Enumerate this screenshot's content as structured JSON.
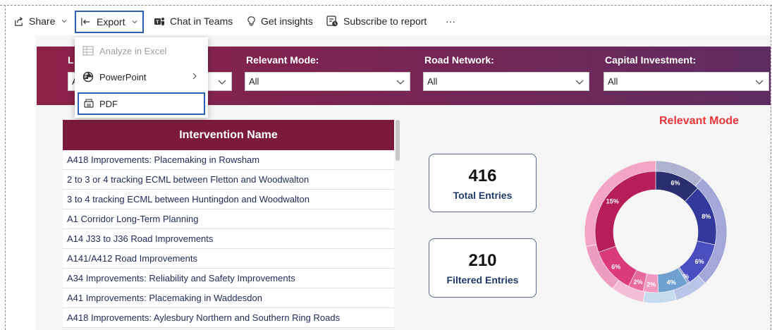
{
  "toolbar": {
    "share_label": "Share",
    "export_label": "Export",
    "chat_label": "Chat in Teams",
    "insights_label": "Get insights",
    "subscribe_label": "Subscribe to report",
    "more_label": "···"
  },
  "export_menu": {
    "items": [
      {
        "label": "Analyze in Excel",
        "disabled": true
      },
      {
        "label": "PowerPoint",
        "has_submenu": true
      },
      {
        "label": "PDF",
        "selected": true
      }
    ]
  },
  "filters": {
    "first": {
      "label_visible": "L",
      "value_visible": "A"
    },
    "relevant_mode": {
      "label": "Relevant Mode:",
      "value": "All"
    },
    "road_network": {
      "label": "Road Network:",
      "value": "All"
    },
    "capital_investment": {
      "label": "Capital Investment:",
      "value": "All"
    }
  },
  "table": {
    "header": "Intervention Name",
    "rows": [
      "A418 Improvements: Placemaking in Rowsham",
      "2 to 3 or 4 tracking ECML between Fletton and Woodwalton",
      "3 to 4 tracking ECML between Huntingdon and Woodwalton",
      "A1 Corridor Long-Term Planning",
      "A14 J33 to J36 Road Improvements",
      "A141/A412 Road Improvements",
      "A34 Improvements: Reliability and Safety Improvements",
      "A41 Improvements: Placemaking in Waddesdon",
      "A418 Improvements: Aylesbury Northern and Southern Ring Roads"
    ]
  },
  "cards": {
    "total": {
      "value": "416",
      "label": "Total Entries"
    },
    "filtered": {
      "value": "210",
      "label": "Filtered Entries"
    }
  },
  "chart_data": {
    "type": "pie",
    "title": "Relevant Mode",
    "inner_ring": [
      {
        "label": "6%",
        "value": 6,
        "color": "#2a2d6e"
      },
      {
        "label": "8%",
        "value": 8,
        "color": "#33399a"
      },
      {
        "label": "6%",
        "value": 6,
        "color": "#4a4fbf"
      },
      {
        "label": "0%",
        "value": 0.3,
        "color": "#8e9bd6"
      },
      {
        "label": "4%",
        "value": 4,
        "color": "#6fa0cf"
      },
      {
        "label": "2%",
        "value": 2,
        "color": "#f19ac0"
      },
      {
        "label": "2%",
        "value": 2,
        "color": "#e86a9c"
      },
      {
        "label": "6%",
        "value": 6,
        "color": "#d93b7d"
      },
      {
        "label": "15%",
        "value": 15,
        "color": "#b51e58"
      }
    ],
    "outer_ring": [
      {
        "value": 6,
        "color": "#aeb1cf"
      },
      {
        "value": 14,
        "color": "#a3a8d8"
      },
      {
        "value": 4,
        "color": "#bcc4ea"
      },
      {
        "value": 4,
        "color": "#c6dbef"
      },
      {
        "value": 4,
        "color": "#f2bfd6"
      },
      {
        "value": 6,
        "color": "#ec9cbf"
      },
      {
        "value": 15,
        "color": "#f2a6c4"
      }
    ]
  },
  "colors": {
    "accent": "#2b5fb8",
    "header_bg": "#7b1a3c",
    "chart_title": "#e8373b"
  }
}
